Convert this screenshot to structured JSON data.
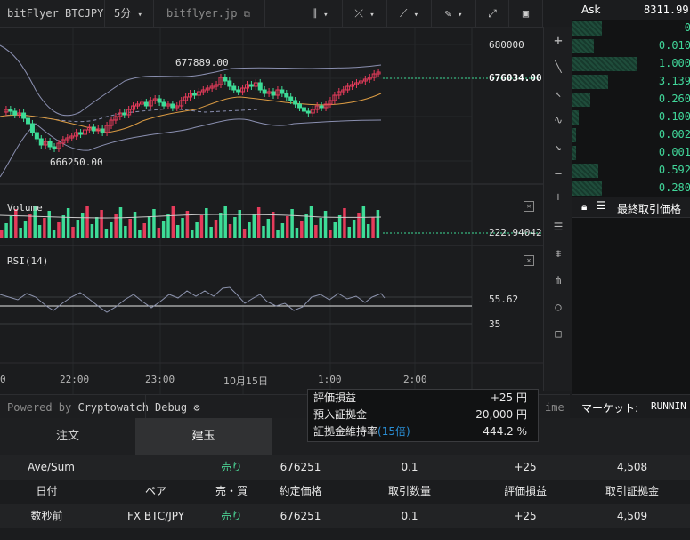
{
  "toolbar": {
    "symbol": "bitFlyer BTCJPY",
    "interval": "5分",
    "exchange_link": "bitflyer.jp"
  },
  "chart": {
    "price_axis": [
      "680000",
      "676034.00"
    ],
    "high_label": "677889.00",
    "low_label": "666250.00",
    "volume_title": "Volume",
    "volume_value": "222.94042",
    "rsi_title": "RSI(14)",
    "rsi_ticks": [
      "55.62",
      "35"
    ],
    "time_axis": [
      "0",
      "22:00",
      "23:00",
      "10月15日",
      "1:00",
      "2:00"
    ],
    "colors": {
      "up": "#e63b5b",
      "down": "#3ddc97",
      "price_line": "#e8e8e8"
    }
  },
  "footer": {
    "powered_prefix": "Powered by",
    "powered_brand": "Cryptowatch",
    "debug_label": "Debug",
    "time_label": "ime"
  },
  "orderbook": {
    "ask_label": "Ask",
    "ask_price": "8311.99",
    "rows": [
      {
        "value": "0",
        "bar": 0.25
      },
      {
        "value": "0.010",
        "bar": 0.18
      },
      {
        "value": "1.000",
        "bar": 0.55
      },
      {
        "value": "3.139",
        "bar": 0.3
      },
      {
        "value": "0.260",
        "bar": 0.15
      },
      {
        "value": "0.100",
        "bar": 0.05
      },
      {
        "value": "0.002",
        "bar": 0.03
      },
      {
        "value": "0.001",
        "bar": 0.03
      },
      {
        "value": "0.592",
        "bar": 0.22
      },
      {
        "value": "0.280",
        "bar": 0.25
      }
    ],
    "last_price_label": "最終取引価格",
    "market_label": "マーケット:",
    "market_status": "RUNNIN"
  },
  "popup": {
    "rows": [
      {
        "label": "評価損益",
        "value": "+25 円"
      },
      {
        "label": "預入証拠金",
        "value": "20,000 円"
      },
      {
        "label": "証拠金維持率",
        "label_suffix": "(15倍)",
        "value": "444.2 %"
      }
    ]
  },
  "positions": {
    "tabs": [
      "注文",
      "建玉"
    ],
    "active_tab": "建玉",
    "summary": {
      "label": "Ave/Sum",
      "side": "売り",
      "price": "676251",
      "qty": "0.1",
      "pnl": "+25",
      "margin": "4,508"
    },
    "headers": [
      "日付",
      "ペア",
      "売・買",
      "約定価格",
      "取引数量",
      "評価損益",
      "取引証拠金"
    ],
    "rows": [
      {
        "date": "数秒前",
        "pair": "FX BTC/JPY",
        "side": "売り",
        "price": "676251",
        "qty": "0.1",
        "pnl": "+25",
        "margin": "4,509"
      }
    ]
  }
}
